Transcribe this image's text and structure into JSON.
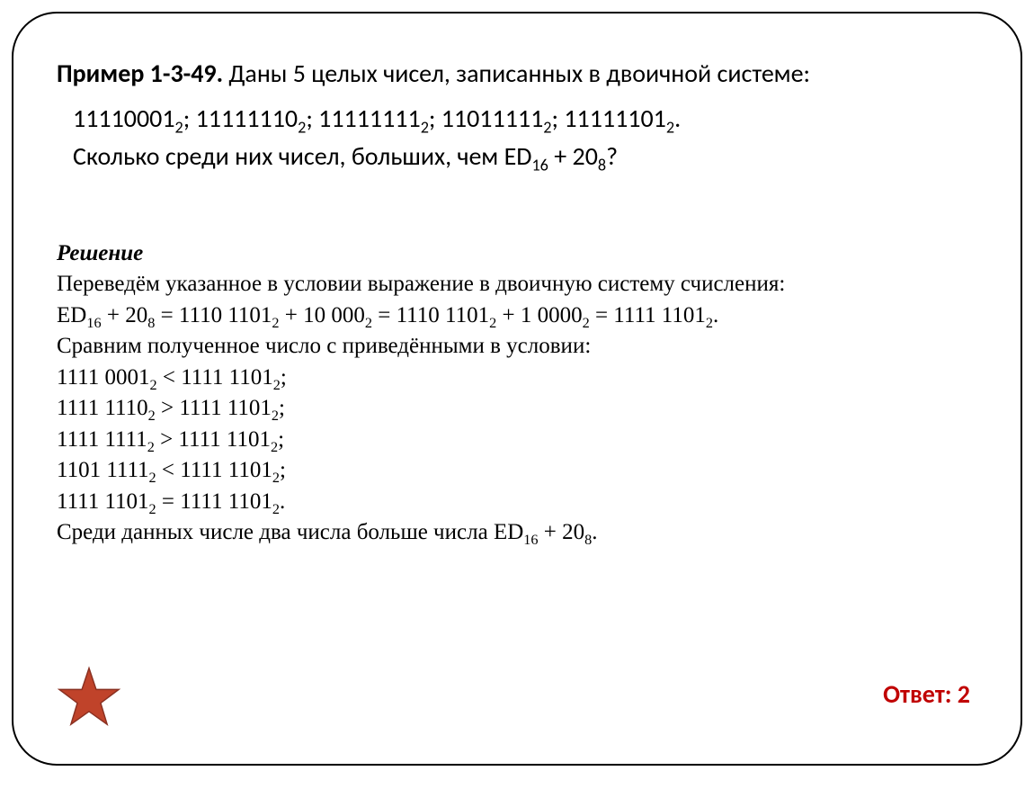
{
  "problem": {
    "label": "Пример 1-3-49.",
    "intro_text": " Даны 5 целых чисел, записанных в двоичной системе:",
    "numbers": [
      {
        "val": "11110001",
        "base": "2"
      },
      {
        "val": "11111110",
        "base": "2"
      },
      {
        "val": "11111111",
        "base": "2"
      },
      {
        "val": "11011111",
        "base": "2"
      },
      {
        "val": "11111101",
        "base": "2"
      }
    ],
    "question_prefix": "Сколько среди них чисел, больших, чем ",
    "expr_a": {
      "val": "ED",
      "base": "16"
    },
    "expr_plus": " + ",
    "expr_b": {
      "val": "20",
      "base": "8"
    },
    "question_suffix": "?"
  },
  "solution": {
    "header": "Решение",
    "line1": "Переведём указанное в условии выражение в двоичную систему счисления:",
    "calc": {
      "a": {
        "val": "ED",
        "base": "16"
      },
      "plus1": " + ",
      "b": {
        "val": "20",
        "base": "8"
      },
      "eq1": " = ",
      "c": {
        "val": "1110 1101",
        "base": "2"
      },
      "plus2": " + ",
      "d": {
        "val": "10 000",
        "base": "2"
      },
      "eq2": " = ",
      "e": {
        "val": "1110 1101",
        "base": "2"
      },
      "plus3": " + ",
      "f": {
        "val": "1 0000",
        "base": "2"
      },
      "eq3": " = ",
      "g": {
        "val": "1111 1101",
        "base": "2"
      },
      "end": "."
    },
    "line2": "Сравним полученное число с приведёнными в условии:",
    "comparisons": [
      {
        "l": {
          "val": "1111 0001",
          "base": "2"
        },
        "op": " < ",
        "r": {
          "val": "1111 1101",
          "base": "2"
        }
      },
      {
        "l": {
          "val": "1111 1110",
          "base": "2"
        },
        "op": " > ",
        "r": {
          "val": "1111 1101",
          "base": "2"
        }
      },
      {
        "l": {
          "val": "1111 1111",
          "base": "2"
        },
        "op": " > ",
        "r": {
          "val": "1111 1101",
          "base": "2"
        }
      },
      {
        "l": {
          "val": "1101 1111",
          "base": "2"
        },
        "op": " < ",
        "r": {
          "val": "1111 1101",
          "base": "2"
        }
      },
      {
        "l": {
          "val": "1111 1101",
          "base": "2"
        },
        "op": " = ",
        "r": {
          "val": "1111 1101",
          "base": "2"
        }
      }
    ],
    "line3_prefix": "Среди данных числе два числа больше числа ",
    "line3_a": {
      "val": "ED",
      "base": "16"
    },
    "line3_plus": " + ",
    "line3_b": {
      "val": "20",
      "base": "8"
    },
    "line3_suffix": "."
  },
  "answer": "Ответ: 2",
  "icons": {
    "star": "star-icon"
  }
}
